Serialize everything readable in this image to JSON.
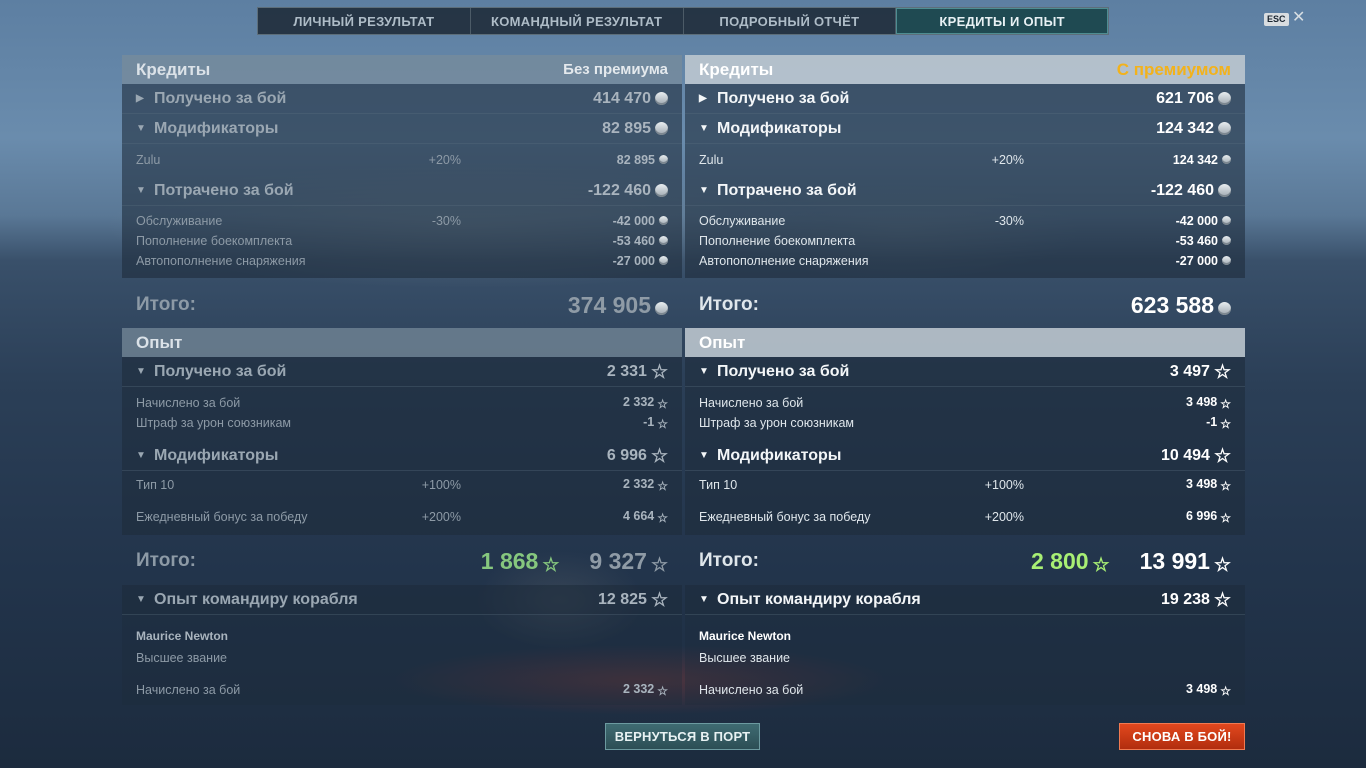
{
  "tabs": [
    "ЛИЧНЫЙ РЕЗУЛЬТАТ",
    "КОМАНДНЫЙ РЕЗУЛЬТАТ",
    "ПОДРОБНЫЙ ОТЧЁТ",
    "КРЕДИТЫ И ОПЫТ"
  ],
  "active_tab": "КРЕДИТЫ И ОПЫТ",
  "esc_label": "ESC",
  "close_glyph": "✕",
  "icons": {
    "credit": "credit-coin-icon",
    "xp": "xp-star-icon",
    "arrow": "expand-arrow-icon"
  },
  "colors": {
    "premium": "#f2b21c",
    "active_tab": "#1f4a52",
    "battle_button": "#d23c18",
    "port_button": "#355d64",
    "free_xp_green": "#a8ef74"
  },
  "left": {
    "credits_title": "Кредиты",
    "account_type": "Без премиума",
    "earned_label": "Получено за бой",
    "earned_value": "414 470",
    "mods_label": "Модификаторы",
    "mods_value": "82 895",
    "zulu_label": "Zulu",
    "zulu_pct": "+20%",
    "zulu_value": "82 895",
    "spent_label": "Потрачено за бой",
    "spent_value": "-122 460",
    "service_label": "Обслуживание",
    "service_pct": "-30%",
    "service_value": "-42 000",
    "ammo_label": "Пополнение боекомплекта",
    "ammo_value": "-53 460",
    "consum_label": "Автопополнение снаряжения",
    "consum_value": "-27 000",
    "credits_total_label": "Итого:",
    "credits_total": "374 905",
    "xp_title": "Опыт",
    "xp_earned_label": "Получено за бой",
    "xp_earned_value": "2 331",
    "xp_base_label": "Начислено за бой",
    "xp_base_value": "2 332",
    "xp_penalty_label": "Штраф за урон союзникам",
    "xp_penalty_value": "-1",
    "xp_mods_label": "Модификаторы",
    "xp_mods_value": "6 996",
    "tier_label": "Тип 10",
    "tier_pct": "+100%",
    "tier_value": "2 332",
    "daily_label": "Ежедневный бонус за победу",
    "daily_pct": "+200%",
    "daily_value": "4 664",
    "xp_total_label": "Итого:",
    "xp_total_free": "1 868",
    "xp_total": "9 327",
    "cmdr_label": "Опыт командиру корабля",
    "cmdr_value": "12 825",
    "cmdr_name": "Maurice Newton",
    "cmdr_rank": "Высшее звание",
    "cmdr_base_label": "Начислено за бой",
    "cmdr_base_value": "2 332"
  },
  "right": {
    "credits_title": "Кредиты",
    "account_type": "С премиумом",
    "earned_label": "Получено за бой",
    "earned_value": "621 706",
    "mods_label": "Модификаторы",
    "mods_value": "124 342",
    "zulu_label": "Zulu",
    "zulu_pct": "+20%",
    "zulu_value": "124 342",
    "spent_label": "Потрачено за бой",
    "spent_value": "-122 460",
    "service_label": "Обслуживание",
    "service_pct": "-30%",
    "service_value": "-42 000",
    "ammo_label": "Пополнение боекомплекта",
    "ammo_value": "-53 460",
    "consum_label": "Автопополнение снаряжения",
    "consum_value": "-27 000",
    "credits_total_label": "Итого:",
    "credits_total": "623 588",
    "xp_title": "Опыт",
    "xp_earned_label": "Получено за бой",
    "xp_earned_value": "3 497",
    "xp_base_label": "Начислено за бой",
    "xp_base_value": "3 498",
    "xp_penalty_label": "Штраф за урон союзникам",
    "xp_penalty_value": "-1",
    "xp_mods_label": "Модификаторы",
    "xp_mods_value": "10 494",
    "tier_label": "Тип 10",
    "tier_pct": "+100%",
    "tier_value": "3 498",
    "daily_label": "Ежедневный бонус за победу",
    "daily_pct": "+200%",
    "daily_value": "6 996",
    "xp_total_label": "Итого:",
    "xp_total_free": "2 800",
    "xp_total": "13 991",
    "cmdr_label": "Опыт командиру корабля",
    "cmdr_value": "19 238",
    "cmdr_name": "Maurice Newton",
    "cmdr_rank": "Высшее звание",
    "cmdr_base_label": "Начислено за бой",
    "cmdr_base_value": "3 498"
  },
  "buttons": {
    "port": "ВЕРНУТЬСЯ В ПОРТ",
    "battle": "СНОВА В БОЙ!"
  }
}
